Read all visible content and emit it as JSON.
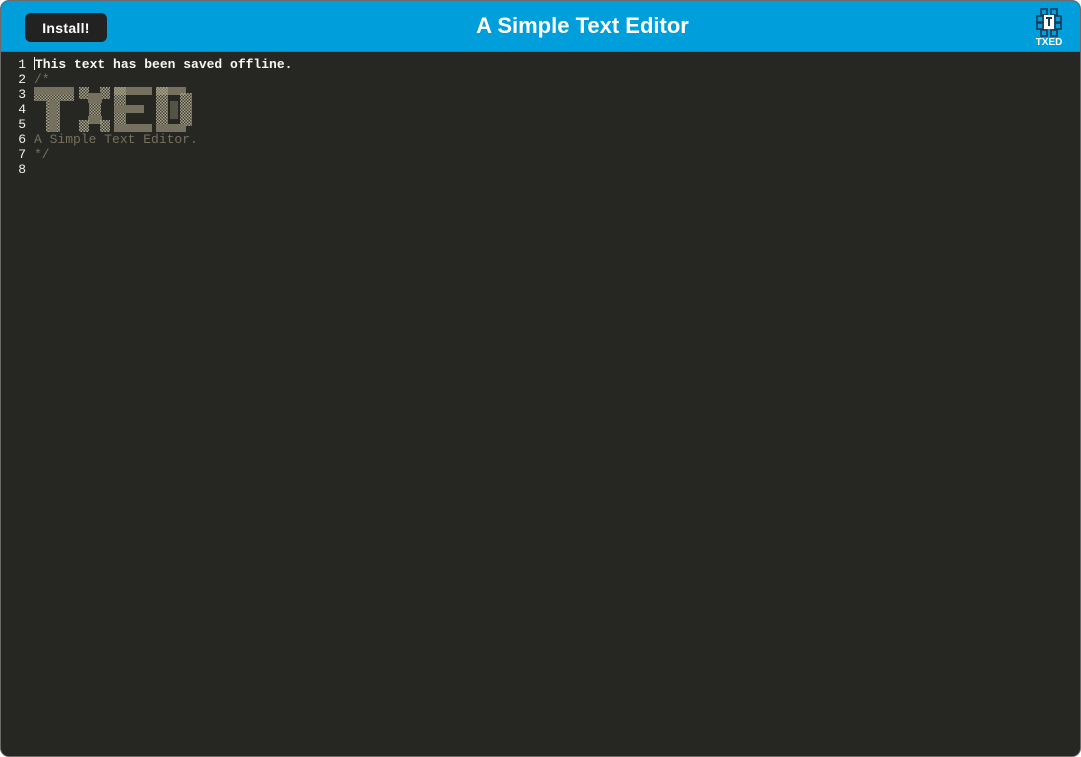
{
  "header": {
    "install_label": "Install!",
    "title": "A Simple Text Editor",
    "logo_text": "TXED"
  },
  "editor": {
    "line_numbers": [
      "1",
      "2",
      "3",
      "4",
      "5",
      "6",
      "7",
      "8"
    ],
    "lines": [
      "This text has been saved offline.",
      "/*",
      "",
      "",
      "",
      "A Simple Text Editor.",
      "*/",
      ""
    ],
    "ascii_art_word": "TXED"
  },
  "colors": {
    "header_bg": "#009fdc",
    "editor_bg": "#262723",
    "comment": "#75715e",
    "text": "#f8f8f2",
    "button_bg": "#222222"
  }
}
